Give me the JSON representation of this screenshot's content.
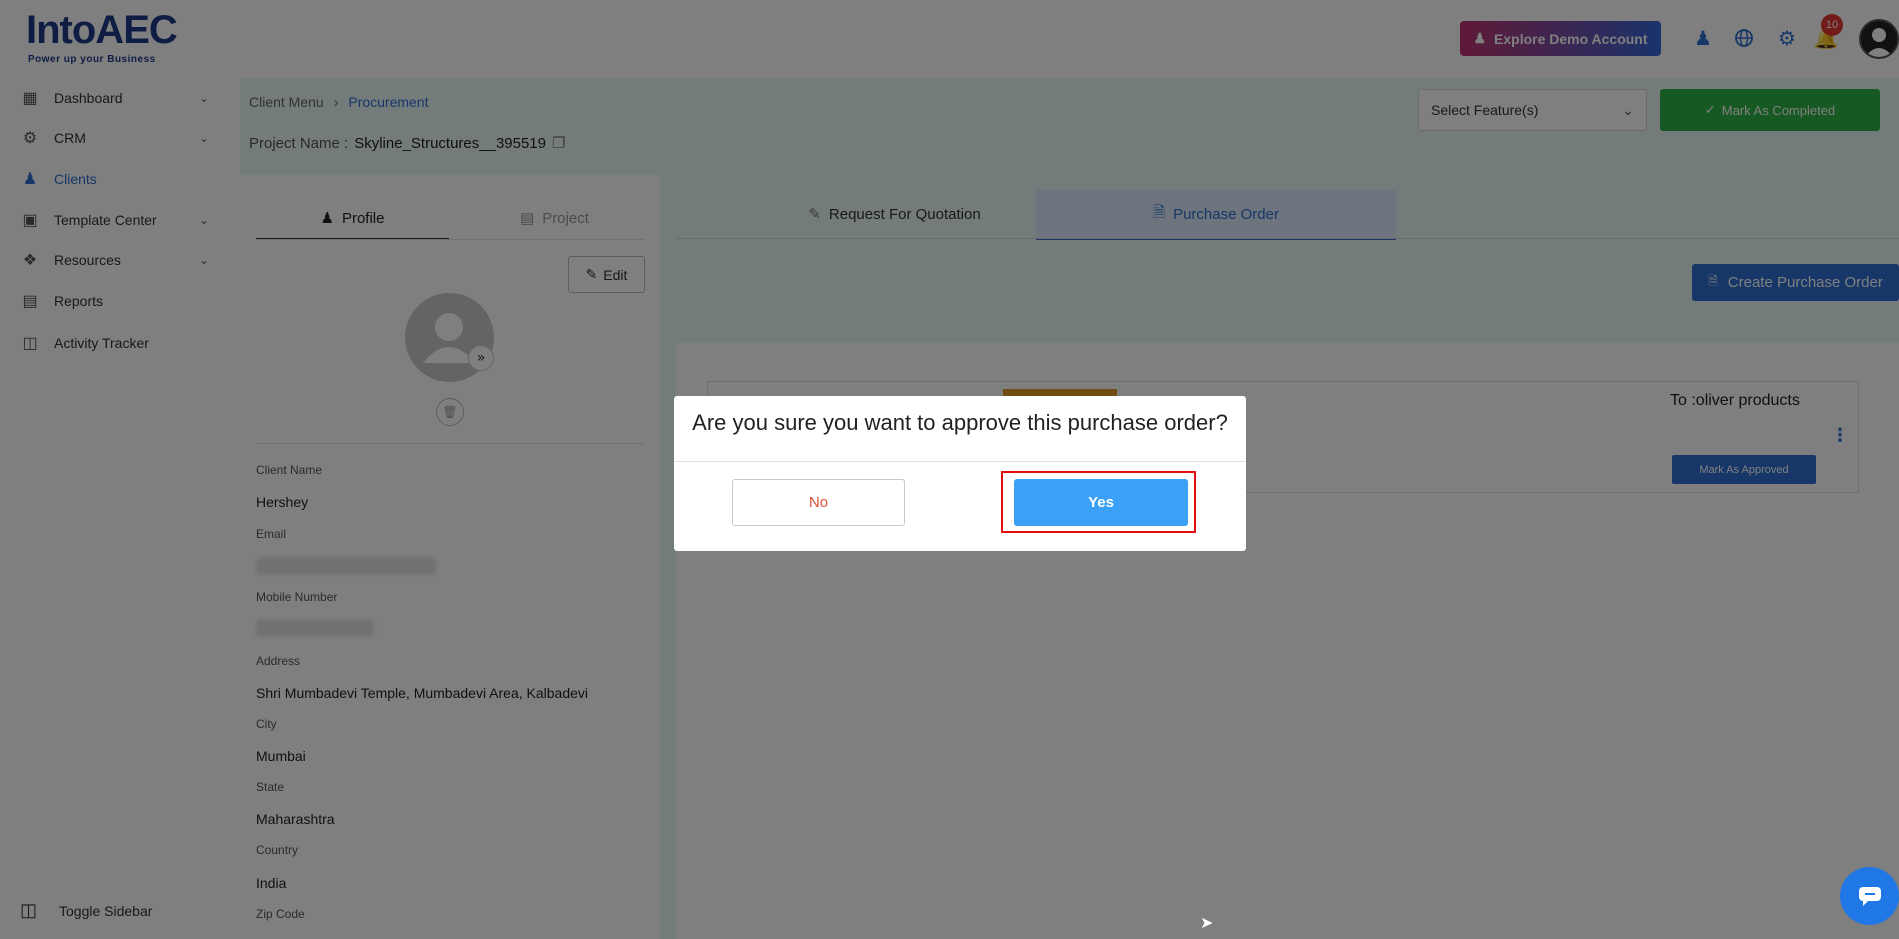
{
  "header": {
    "logo_text": "IntoAEC",
    "logo_tagline": "Power up your Business",
    "demo_button": "Explore Demo Account",
    "notifications_count": "10"
  },
  "sidebar": {
    "items": [
      {
        "label": "Dashboard",
        "icon": "dashboard-icon",
        "expandable": true
      },
      {
        "label": "CRM",
        "icon": "crm-icon",
        "expandable": true
      },
      {
        "label": "Clients",
        "icon": "clients-icon",
        "expandable": false,
        "active": true
      },
      {
        "label": "Template Center",
        "icon": "template-icon",
        "expandable": true
      },
      {
        "label": "Resources",
        "icon": "resources-icon",
        "expandable": true
      },
      {
        "label": "Reports",
        "icon": "reports-icon",
        "expandable": false
      },
      {
        "label": "Activity Tracker",
        "icon": "activity-icon",
        "expandable": false
      }
    ],
    "toggle_label": "Toggle Sidebar"
  },
  "breadcrumb": {
    "parent": "Client Menu",
    "current": "Procurement"
  },
  "project": {
    "label": "Project Name :",
    "name": "Skyline_Structures__395519"
  },
  "toolbar": {
    "feature_select": "Select Feature(s)",
    "mark_completed": "Mark As Completed"
  },
  "profile": {
    "tabs": [
      "Profile",
      "Project"
    ],
    "edit_label": "Edit",
    "fields": {
      "client_name_label": "Client Name",
      "client_name": "Hershey",
      "email_label": "Email",
      "mobile_label": "Mobile Number",
      "address_label": "Address",
      "address": "Shri Mumbadevi Temple, Mumbadevi Area, Kalbadevi",
      "city_label": "City",
      "city": "Mumbai",
      "state_label": "State",
      "state": "Maharashtra",
      "country_label": "Country",
      "country": "India",
      "zip_label": "Zip Code"
    }
  },
  "procurement": {
    "tabs": [
      "Request For Quotation",
      "Purchase Order"
    ],
    "active_tab": "Purchase Order",
    "create_button": "Create Purchase Order",
    "po_card": {
      "to": "To :oliver products",
      "approve_button": "Mark As Approved"
    }
  },
  "modal": {
    "question": "Are you sure you want to approve this purchase order?",
    "no_label": "No",
    "yes_label": "Yes"
  },
  "colors": {
    "brand_blue": "#2f6fd1",
    "success_green": "#2fb344",
    "yes_blue": "#3aa1f7",
    "no_red": "#e0513a",
    "highlight_red": "#e01010"
  }
}
